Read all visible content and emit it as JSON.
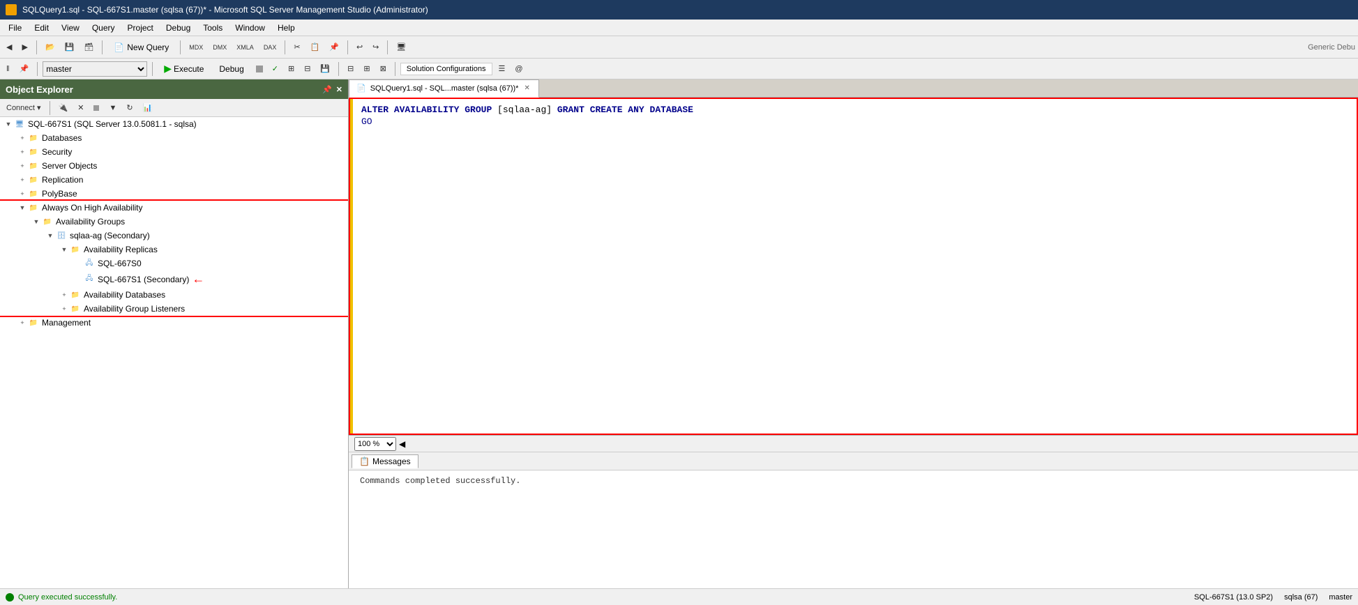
{
  "titleBar": {
    "title": "SQLQuery1.sql - SQL-667S1.master (sqlsa (67))* - Microsoft SQL Server Management Studio (Administrator)",
    "icon": "ssms-icon"
  },
  "menuBar": {
    "items": [
      "File",
      "Edit",
      "View",
      "Query",
      "Project",
      "Debug",
      "Tools",
      "Window",
      "Help"
    ]
  },
  "toolbar": {
    "newQueryLabel": "New Query",
    "buttons": [
      "back",
      "forward",
      "open",
      "save",
      "saveall",
      "newquery",
      "cut",
      "copy",
      "paste",
      "undo",
      "redo",
      "debug"
    ]
  },
  "toolbar2": {
    "database": "master",
    "executeLabel": "Execute",
    "debugLabel": "Debug",
    "solutionConfigurations": "Solution Configurations"
  },
  "objectExplorer": {
    "title": "Object Explorer",
    "connectLabel": "Connect",
    "rootNode": "SQL-667S1 (SQL Server 13.0.5081.1 - sqlsa)",
    "nodes": [
      {
        "id": "databases",
        "label": "Databases",
        "level": 1,
        "expanded": false,
        "type": "folder"
      },
      {
        "id": "security",
        "label": "Security",
        "level": 1,
        "expanded": false,
        "type": "folder"
      },
      {
        "id": "serverobjects",
        "label": "Server Objects",
        "level": 1,
        "expanded": false,
        "type": "folder"
      },
      {
        "id": "replication",
        "label": "Replication",
        "level": 1,
        "expanded": false,
        "type": "folder"
      },
      {
        "id": "polybase",
        "label": "PolyBase",
        "level": 1,
        "expanded": false,
        "type": "folder"
      },
      {
        "id": "alwayson",
        "label": "Always On High Availability",
        "level": 1,
        "expanded": true,
        "type": "folder",
        "highlighted": true
      },
      {
        "id": "availgroups",
        "label": "Availability Groups",
        "level": 2,
        "expanded": true,
        "type": "folder",
        "highlighted": true
      },
      {
        "id": "sqlaag",
        "label": "sqlaa-ag (Secondary)",
        "level": 3,
        "expanded": true,
        "type": "agnode",
        "highlighted": true
      },
      {
        "id": "availreplicas",
        "label": "Availability Replicas",
        "level": 4,
        "expanded": true,
        "type": "folder",
        "highlighted": true
      },
      {
        "id": "sql667s0",
        "label": "SQL-667S0",
        "level": 5,
        "expanded": false,
        "type": "replica",
        "highlighted": true
      },
      {
        "id": "sql667s1",
        "label": "SQL-667S1 (Secondary)",
        "level": 5,
        "expanded": false,
        "type": "replica",
        "highlighted": true,
        "hasArrow": true
      },
      {
        "id": "availdbs",
        "label": "Availability Databases",
        "level": 4,
        "expanded": false,
        "type": "folder",
        "highlighted": true
      },
      {
        "id": "availlisteners",
        "label": "Availability Group Listeners",
        "level": 4,
        "expanded": false,
        "type": "folder",
        "highlighted": true
      },
      {
        "id": "management",
        "label": "Management",
        "level": 1,
        "expanded": false,
        "type": "folder"
      }
    ]
  },
  "editor": {
    "tabLabel": "SQLQuery1.sql - SQL...master (sqlsa (67))*",
    "code": {
      "line1": "ALTER AVAILABILITY GROUP [sqlaa-ag] GRANT CREATE ANY DATABASE",
      "line2": "GO"
    },
    "keywords": {
      "alter": "ALTER",
      "availability": "AVAILABILITY",
      "group": "GROUP",
      "grant": "GRANT",
      "create": "CREATE",
      "any": "ANY",
      "database": "DATABASE",
      "go": "GO"
    }
  },
  "results": {
    "zoomLevel": "100 %",
    "tabLabel": "Messages",
    "message": "Commands completed successfully."
  },
  "statusBar": {
    "message": "Query executed successfully.",
    "server": "SQL-667S1 (13.0 SP2)",
    "user": "sqlsa (67)",
    "database": "master"
  }
}
